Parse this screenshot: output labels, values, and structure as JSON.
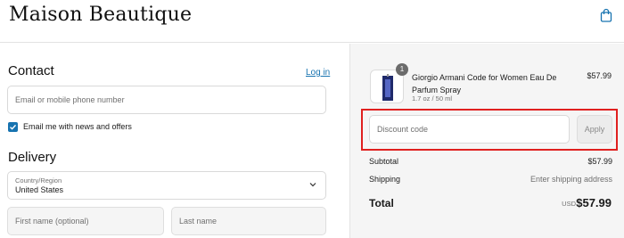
{
  "header": {
    "brand": "Maison Beautique",
    "cart_icon": "shopping-bag-icon"
  },
  "contact": {
    "title": "Contact",
    "login_link": "Log in",
    "email_placeholder": "Email or mobile phone number",
    "newsletter_checked": true,
    "newsletter_label": "Email me with news and offers"
  },
  "delivery": {
    "title": "Delivery",
    "country_label": "Country/Region",
    "country_value": "United States",
    "first_name_placeholder": "First name (optional)",
    "last_name_placeholder": "Last name"
  },
  "summary": {
    "product": {
      "quantity": "1",
      "name": "Giorgio Armani Code for Women Eau De Parfum Spray",
      "variant": "1.7 oz / 50 ml",
      "price": "$57.99"
    },
    "discount_placeholder": "Discount code",
    "apply_label": "Apply",
    "subtotal_label": "Subtotal",
    "subtotal_value": "$57.99",
    "shipping_label": "Shipping",
    "shipping_value": "Enter shipping address",
    "total_label": "Total",
    "total_currency": "USD",
    "total_value": "$57.99"
  },
  "colors": {
    "accent": "#1773b0",
    "highlight": "#e0201f"
  }
}
